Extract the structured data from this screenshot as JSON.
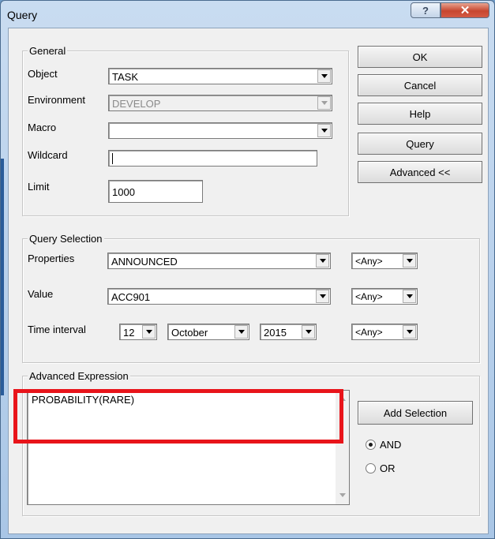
{
  "window": {
    "title": "Query",
    "help_glyph": "?",
    "close_glyph": "✕"
  },
  "general": {
    "legend": "General",
    "object": {
      "label": "Object",
      "value": "TASK"
    },
    "environment": {
      "label": "Environment",
      "value": "DEVELOP"
    },
    "macro": {
      "label": "Macro",
      "value": ""
    },
    "wildcard": {
      "label": "Wildcard",
      "value": ""
    },
    "limit": {
      "label": "Limit",
      "value": "1000"
    }
  },
  "buttons": {
    "ok": "OK",
    "cancel": "Cancel",
    "help": "Help",
    "query": "Query",
    "advanced": "Advanced <<",
    "add_selection": "Add Selection"
  },
  "query_selection": {
    "legend": "Query Selection",
    "properties": {
      "label": "Properties",
      "value": "ANNOUNCED",
      "op": "<Any>"
    },
    "value": {
      "label": "Value",
      "value": "ACC901",
      "op": "<Any>"
    },
    "time_interval": {
      "label": "Time interval",
      "day": "12",
      "month": "October",
      "year": "2015",
      "op": "<Any>"
    }
  },
  "advanced_expression": {
    "legend": "Advanced Expression",
    "text": "PROBABILITY(RARE)",
    "radio_and": "AND",
    "radio_or": "OR",
    "selected": "AND"
  },
  "colors": {
    "highlight": "#e8141a",
    "dialog_bg": "#f0f0f0",
    "close_button": "#c7462f"
  }
}
